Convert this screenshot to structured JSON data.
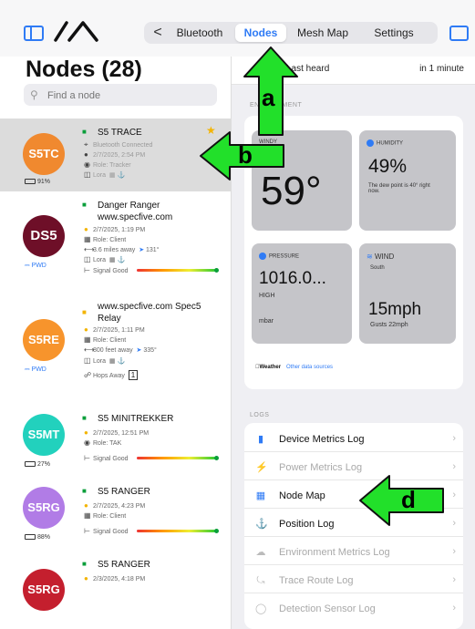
{
  "header": {
    "tabs": [
      {
        "label": "Bluetooth",
        "active": false
      },
      {
        "label": "Nodes",
        "active": true
      },
      {
        "label": "Mesh Map",
        "active": false
      },
      {
        "label": "Settings",
        "active": false
      }
    ],
    "back_glyph": "<"
  },
  "sidebar": {
    "title": "Nodes (28)",
    "search_placeholder": "Find a node",
    "nodes": [
      {
        "short_name": "S5TC",
        "long_name": "S5 TRACE",
        "color": "#f0892f",
        "selected": true,
        "favorite": true,
        "details": [
          "Bluetooth Connected",
          "2/7/2025, 2:54 PM",
          "Role: Tracker",
          "Lora"
        ],
        "battery": "91%"
      },
      {
        "short_name": "DS5",
        "long_name": "Danger Ranger www.specfive.com",
        "color": "#6e0f28",
        "selected": false,
        "favorite": false,
        "details": [
          "2/7/2025, 1:19 PM",
          "Role: Client",
          "3.6 miles away",
          "131°",
          "Lora",
          "Signal Good"
        ],
        "battery": "PWD"
      },
      {
        "short_name": "S5RE",
        "long_name": "www.specfive.com Spec5 Relay",
        "color": "#f7942c",
        "selected": false,
        "favorite": false,
        "details": [
          "2/7/2025, 1:11 PM",
          "Role: Client",
          "800 feet away",
          "335°",
          "Lora",
          "Hops Away",
          "1"
        ],
        "battery": "PWD"
      },
      {
        "short_name": "S5MT",
        "long_name": "S5 MINITREKKER",
        "color": "#22d1bd",
        "selected": false,
        "favorite": false,
        "details": [
          "2/7/2025, 12:51 PM",
          "Role: TAK",
          "Signal Good"
        ],
        "battery": "27%"
      },
      {
        "short_name": "S5RG",
        "long_name": "S5 RANGER",
        "color": "#b17ce6",
        "selected": false,
        "favorite": false,
        "details": [
          "2/7/2025, 4:23 PM",
          "Role: Client",
          "Signal Good"
        ],
        "battery": "88%"
      },
      {
        "short_name": "S5RG",
        "long_name": "S5 RANGER",
        "color": "#c41f2e",
        "selected": false,
        "favorite": false,
        "details": [
          "2/3/2025, 4:18 PM"
        ],
        "battery": ""
      }
    ]
  },
  "detail": {
    "last_heard_label": "Last heard",
    "last_heard_value": "in 1 minute",
    "environment_header": "ENVIRONMENT",
    "tiles": {
      "weather": {
        "label": "WINDY",
        "value": "59°"
      },
      "humidity": {
        "label": "HUMIDITY",
        "value": "49%",
        "note": "The dew point is 40° right now."
      },
      "pressure": {
        "label": "PRESSURE",
        "value": "1016.0...",
        "level": "HIGH",
        "unit": "mbar"
      },
      "wind": {
        "label": "WIND",
        "direction": "South",
        "value": "15mph",
        "gusts": "Gusts 22mph"
      }
    },
    "weather_attribution": "Weather",
    "weather_link": "Other data sources",
    "logs_header": "LOGS",
    "logs": [
      {
        "label": "Device Metrics Log",
        "icon": "device-icon",
        "enabled": true
      },
      {
        "label": "Power Metrics Log",
        "icon": "bolt-icon",
        "enabled": false
      },
      {
        "label": "Node Map",
        "icon": "map-icon",
        "enabled": true
      },
      {
        "label": "Position Log",
        "icon": "position-icon",
        "enabled": true
      },
      {
        "label": "Environment Metrics Log",
        "icon": "cloud-icon",
        "enabled": false
      },
      {
        "label": "Trace Route Log",
        "icon": "route-icon",
        "enabled": false
      },
      {
        "label": "Detection Sensor Log",
        "icon": "sensor-icon",
        "enabled": false
      }
    ]
  },
  "annotations": {
    "a": "a",
    "b": "b",
    "d": "d",
    "color": "#22e02a"
  }
}
